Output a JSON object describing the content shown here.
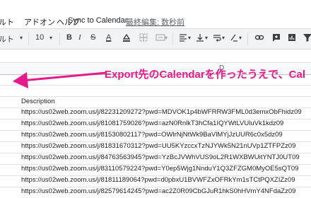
{
  "menu": {
    "items": [
      "ルト",
      "アドオン",
      "ヘルプ",
      "Sync to Calendar"
    ],
    "last_edit": "最終編集: 数秒前"
  },
  "toolbar": {
    "font": "ルト",
    "font_size": "10",
    "bold": "B",
    "italic": "I",
    "strike": "S",
    "text_color": "A"
  },
  "sheet": {
    "column_header": "D",
    "header_cell": "Description",
    "rows": [
      "https://us02web.zoom.us/j/82231209272?pwd=MDVOK1p4bWFRRW3FML0d3emxObFhidz09",
      "https://us02web.zoom.us/j/81081759026?pwd=azN0RnlkT3hCfa1IQYWtLVUluVk1kdz09",
      "https://us02web.zoom.us/j/81530802117?pwd=OWlrNjNtWk9BaVlMYjJzUUR6c0x5dz09",
      "https://us02web.zoom.us/j/81831670312?pwd=UU5KYzccxTzNJYWk5N21nUVp1ZTFPZz09",
      "https://us02web.zoom.us/j/84763563945?pwd=YzBcJVWhVUS9oL2R1WXBWUitYNTJ0UT09",
      "https://us02web.zoom.us/j/83110579224?pwd=Y0ep5Wjg1NnduY1Q3ZFZGM0MyOE5sQT09",
      "https://us02web.zoom.us/j/81811189064?pwd=d0pbxU1BVWFZxOFRkYm1sTCtPQXZIZz09",
      "https://us02web.zoom.us/j/82579614245?pwd=ac2Z0R09CbGJuR1hkS0hHVmY4NFdaZz09"
    ]
  },
  "annotation": {
    "text": "Export先のCalendarを作ったうえで、Cal",
    "color": "#e8198b"
  }
}
